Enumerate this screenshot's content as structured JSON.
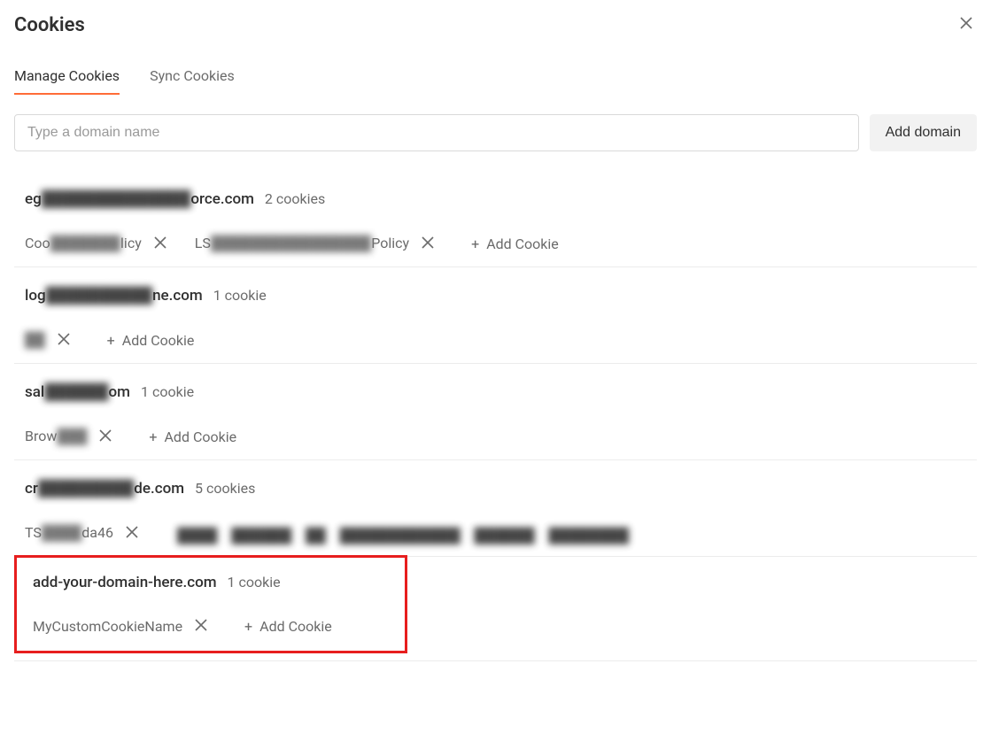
{
  "title": "Cookies",
  "tabs": {
    "manage": "Manage Cookies",
    "sync": "Sync Cookies"
  },
  "search": {
    "placeholder": "Type a domain name",
    "add_button": "Add domain"
  },
  "add_cookie_label": "Add Cookie",
  "domains": [
    {
      "name_vis": "eg",
      "name_blur": "██████████████",
      "name_vis_end": "orce.com",
      "count": "2 cookies",
      "cookies": [
        {
          "vis": "Coo",
          "blur": "███████",
          "vis_end": "licy"
        },
        {
          "vis": "LS",
          "blur": "████████████████",
          "vis_end": "Policy"
        }
      ]
    },
    {
      "name_vis": "log",
      "name_blur": "██████████",
      "name_vis_end": "ne.com",
      "count": "1 cookie",
      "cookies": [
        {
          "vis": "",
          "blur": "██",
          "vis_end": ""
        }
      ]
    },
    {
      "name_vis": "sal",
      "name_blur": "██████",
      "name_vis_end": "om",
      "count": "1 cookie",
      "cookies": [
        {
          "vis": "Brow",
          "blur": "███",
          "vis_end": ""
        }
      ]
    },
    {
      "name_vis": "cr",
      "name_blur": "█████████",
      "name_vis_end": "de.com",
      "count": "5 cookies",
      "cookies": [
        {
          "vis": "TS",
          "blur": "████",
          "vis_end": "da46"
        }
      ],
      "trail_blur": true
    },
    {
      "name_full": "add-your-domain-here.com",
      "count": "1 cookie",
      "cookies": [
        {
          "name_full": "MyCustomCookieName"
        }
      ],
      "highlighted": true
    }
  ]
}
